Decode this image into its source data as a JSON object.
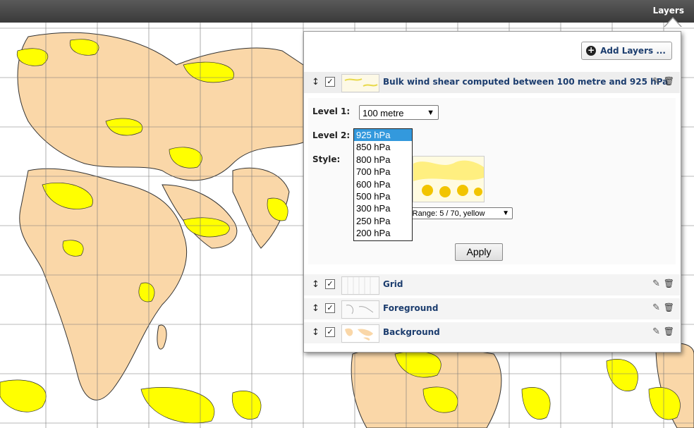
{
  "topbar": {
    "title": "Layers"
  },
  "panel": {
    "add_layers_label": "Add Layers ...",
    "layers": [
      {
        "name": "Bulk wind shear computed between 100 metre and 925 hPa",
        "checked": true,
        "icon": "thumb-windshear"
      },
      {
        "name": "Grid",
        "checked": true,
        "icon": "thumb-grid"
      },
      {
        "name": "Foreground",
        "checked": true,
        "icon": "thumb-foreground"
      },
      {
        "name": "Background",
        "checked": true,
        "icon": "thumb-background"
      }
    ],
    "settings": {
      "level1_label": "Level 1:",
      "level1_value": "100 metre",
      "level2_label": "Level 2:",
      "level2_options": [
        "925 hPa",
        "850 hPa",
        "800 hPa",
        "700 hPa",
        "600 hPa",
        "500 hPa",
        "300 hPa",
        "250 hPa",
        "200 hPa"
      ],
      "level2_selected": "925 hPa",
      "style_label": "Style:",
      "style_value": "(Range: 5 / 70, yellow",
      "apply_label": "Apply"
    }
  },
  "colors": {
    "land": "#fad7a8",
    "shear": "#ffff00",
    "accent": "#1c3d6e",
    "selected_option": "#3399dd"
  }
}
